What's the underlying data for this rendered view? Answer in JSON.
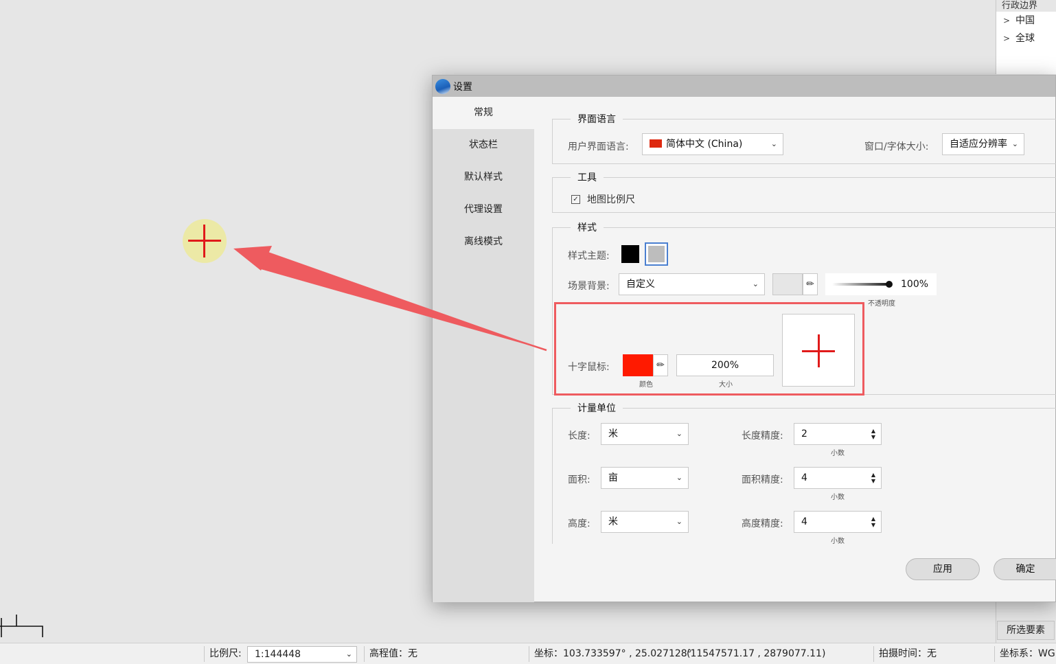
{
  "layers": {
    "header": "行政边界",
    "items": [
      "中国",
      "全球"
    ]
  },
  "map": {
    "select_button": "所选要素"
  },
  "statusbar": {
    "scale_label": "比例尺:",
    "scale_value": "1:144448",
    "elevation": "高程值：无",
    "coordinate": "坐标：103.733597° , 25.027128°",
    "projected": "(11547571.17 , 2879077.11)",
    "capture_time": "拍摄时间：无",
    "crs": "坐标系：WG"
  },
  "dialog": {
    "title": "设置",
    "nav": [
      "常规",
      "状态栏",
      "默认样式",
      "代理设置",
      "离线模式"
    ],
    "language_group": {
      "title": "界面语言",
      "ui_language_label": "用户界面语言:",
      "ui_language_value": "简体中文 (China)",
      "window_font_label": "窗口/字体大小:",
      "window_font_value": "自适应分辨率"
    },
    "tools_group": {
      "title": "工具",
      "map_scale_checkbox": "地图比例尺",
      "check_mark": "✓"
    },
    "style_group": {
      "title": "样式",
      "theme_label": "样式主题:",
      "scene_bg_label": "场景背景:",
      "scene_bg_value": "自定义",
      "opacity_value": "100%",
      "opacity_caption": "不透明度",
      "crosshair_label": "十字鼠标:",
      "color_caption": "颜色",
      "size_value": "200%",
      "size_caption": "大小",
      "crosshair_color": "#ff1a00"
    },
    "units_group": {
      "title": "计量单位",
      "length_label": "长度:",
      "length_value": "米",
      "area_label": "面积:",
      "area_value": "亩",
      "height_label": "高度:",
      "height_value": "米",
      "length_precision_label": "长度精度:",
      "length_precision_value": "2",
      "area_precision_label": "面积精度:",
      "area_precision_value": "4",
      "height_precision_label": "高度精度:",
      "height_precision_value": "4",
      "decimal_caption": "小数"
    },
    "buttons": {
      "apply": "应用",
      "ok": "确定"
    }
  },
  "colors": {
    "accent_red": "#ee5b5f",
    "crosshair_red": "#e01a1a",
    "theme_dark": "#000000",
    "theme_light": "#bdbdbd"
  }
}
